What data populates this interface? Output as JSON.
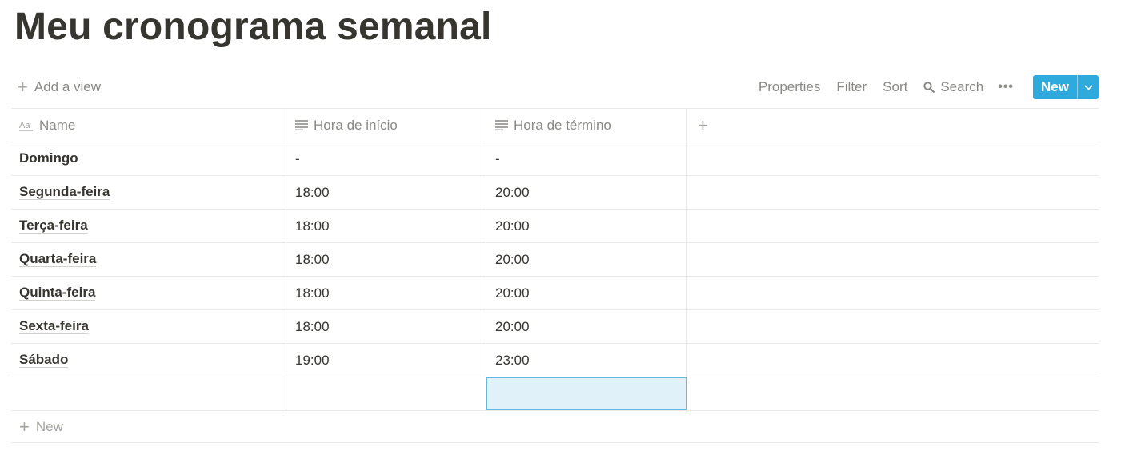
{
  "page": {
    "title": "Meu cronograma semanal"
  },
  "toolbar": {
    "add_view_label": "Add a view",
    "properties_label": "Properties",
    "filter_label": "Filter",
    "sort_label": "Sort",
    "search_label": "Search",
    "more_label": "•••",
    "new_label": "New"
  },
  "table": {
    "columns": [
      {
        "label": "Name",
        "icon": "title-property-icon"
      },
      {
        "label": "Hora de início",
        "icon": "text-property-icon"
      },
      {
        "label": "Hora de término",
        "icon": "text-property-icon"
      }
    ],
    "rows": [
      {
        "name": "Domingo",
        "start": "-",
        "end": "-"
      },
      {
        "name": "Segunda-feira",
        "start": "18:00",
        "end": "20:00"
      },
      {
        "name": "Terça-feira",
        "start": "18:00",
        "end": "20:00"
      },
      {
        "name": "Quarta-feira",
        "start": "18:00",
        "end": "20:00"
      },
      {
        "name": "Quinta-feira",
        "start": "18:00",
        "end": "20:00"
      },
      {
        "name": "Sexta-feira",
        "start": "18:00",
        "end": "20:00"
      },
      {
        "name": "Sábado",
        "start": "19:00",
        "end": "23:00"
      }
    ],
    "add_row_label": "New"
  },
  "colors": {
    "accent": "#2eaadc",
    "text": "#37352f",
    "muted": "#8a8985",
    "selection": "#e0f1fa"
  }
}
